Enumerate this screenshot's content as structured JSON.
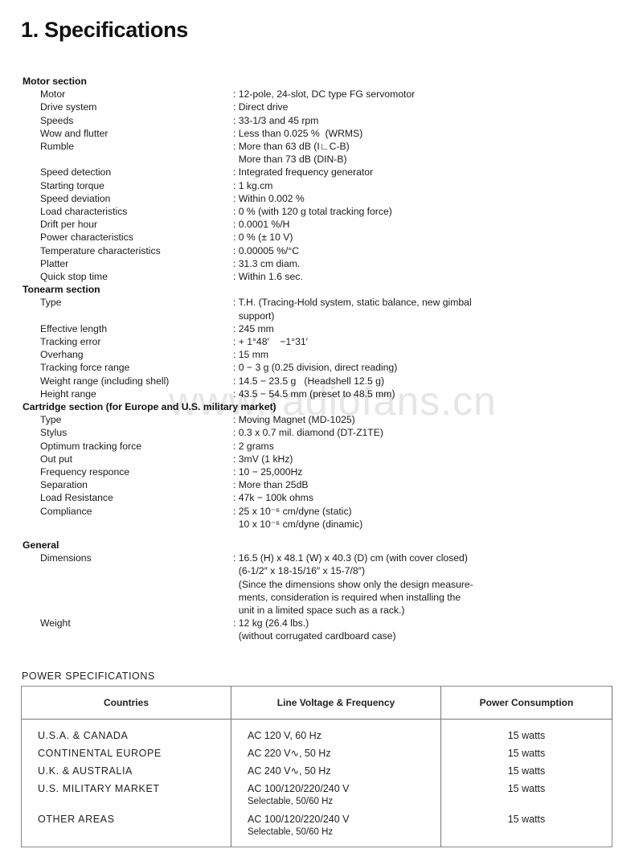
{
  "page": {
    "title": "1. Specifications",
    "watermark": "www.radiofans.cn"
  },
  "sections": [
    {
      "heading": "Motor section",
      "items": [
        {
          "label": "Motor",
          "values": [
            ": 12-pole, 24-slot, DC type FG servomotor"
          ]
        },
        {
          "label": "Drive system",
          "values": [
            ": Direct drive"
          ]
        },
        {
          "label": "Speeds",
          "values": [
            ": 33-1/3 and 45 rpm"
          ]
        },
        {
          "label": "Wow and flutter",
          "values": [
            ": Less than 0.025 %  (WRMS)"
          ]
        },
        {
          "label": "Rumble",
          "values": [
            ": More than 63 dB (I∟C-B)",
            "  More than 73 dB (DIN-B)"
          ]
        },
        {
          "label": "Speed detection",
          "values": [
            ": Integrated frequency generator"
          ]
        },
        {
          "label": "Starting torque",
          "values": [
            ": 1 kg.cm"
          ]
        },
        {
          "label": "Speed deviation",
          "values": [
            ": Within 0.002 %"
          ]
        },
        {
          "label": "Load characteristics",
          "values": [
            ": 0 % (with 120 g total tracking force)"
          ]
        },
        {
          "label": "Drift per hour",
          "values": [
            ": 0.0001 %/H"
          ]
        },
        {
          "label": "Power characteristics",
          "values": [
            ": 0 % (± 10 V)"
          ]
        },
        {
          "label": "Temperature characteristics",
          "values": [
            ": 0.00005 %/°C"
          ]
        },
        {
          "label": "Platter",
          "values": [
            ": 31.3 cm diam."
          ]
        },
        {
          "label": "Quick stop time",
          "values": [
            ": Within 1.6 sec."
          ]
        }
      ]
    },
    {
      "heading": "Tonearm section",
      "items": [
        {
          "label": "Type",
          "values": [
            ": T.H. (Tracing-Hold system, static balance, new gimbal",
            "  support)"
          ]
        },
        {
          "label": "Effective length",
          "values": [
            ": 245 mm"
          ]
        },
        {
          "label": "Tracking error",
          "values": [
            ": + 1°48′    −1°31′"
          ]
        },
        {
          "label": "Overhang",
          "values": [
            ": 15 mm"
          ]
        },
        {
          "label": "Tracking force range",
          "values": [
            ": 0 − 3 g (0.25 division, direct reading)"
          ]
        },
        {
          "label": "Weight range (including shell)",
          "values": [
            ": 14.5 − 23.5 g   (Headshell 12.5 g)"
          ]
        },
        {
          "label": "Height range",
          "values": [
            ": 43.5 − 54.5 mm (preset to 48.5 mm)"
          ]
        }
      ]
    },
    {
      "heading": "Cartridge section (for Europe and U.S. military market)",
      "items": [
        {
          "label": "Type",
          "values": [
            ": Moving Magnet (MD-1025)"
          ]
        },
        {
          "label": "Stylus",
          "values": [
            ": 0.3 x 0.7 mil. diamond (DT-Z1TE)"
          ]
        },
        {
          "label": "Optimum tracking force",
          "values": [
            ": 2 grams"
          ]
        },
        {
          "label": "Out put",
          "values": [
            ": 3mV (1 kHz)"
          ]
        },
        {
          "label": "Frequency responce",
          "values": [
            ": 10 − 25,000Hz"
          ]
        },
        {
          "label": "Separation",
          "values": [
            ": More than 25dB"
          ]
        },
        {
          "label": "Load Resistance",
          "values": [
            ": 47k − 100k ohms"
          ]
        },
        {
          "label": "Compliance",
          "values": [
            ": 25 x 10⁻⁶ cm/dyne (static)",
            "  10 x 10⁻⁶ cm/dyne (dinamic)"
          ]
        }
      ]
    },
    {
      "heading": "General",
      "items": [
        {
          "label": "Dimensions",
          "values": [
            ": 16.5 (H) x 48.1 (W) x 40.3 (D) cm (with cover closed)",
            "  (6-1/2″ x 18-15/16″ x 15-7/8″)",
            "  (Since the dimensions show only the design measure-",
            "  ments, consideration is required when installing the",
            "  unit in a limited space such as a rack.)"
          ]
        },
        {
          "label": "Weight",
          "values": [
            ": 12 kg (26.4 lbs.)",
            "  (without corrugated cardboard case)"
          ]
        }
      ]
    }
  ],
  "power": {
    "title": "POWER SPECIFICATIONS",
    "headers": [
      "Countries",
      "Line Voltage & Frequency",
      "Power Consumption"
    ],
    "rows": [
      {
        "country": "U.S.A. & CANADA",
        "voltage": [
          "AC 120 V, 60 Hz"
        ],
        "consumption": "15 watts"
      },
      {
        "country": "CONTINENTAL EUROPE",
        "voltage": [
          "AC 220 V∿, 50 Hz"
        ],
        "consumption": "15 watts"
      },
      {
        "country": "U.K. & AUSTRALIA",
        "voltage": [
          "AC 240 V∿, 50 Hz"
        ],
        "consumption": "15 watts"
      },
      {
        "country": "U.S. MILITARY MARKET",
        "voltage": [
          "AC 100/120/220/240 V",
          "Selectable, 50/60 Hz"
        ],
        "consumption": "15 watts"
      },
      {
        "country": "OTHER AREAS",
        "voltage": [
          "AC 100/120/220/240 V",
          "Selectable, 50/60 Hz"
        ],
        "consumption": "15 watts"
      }
    ]
  }
}
